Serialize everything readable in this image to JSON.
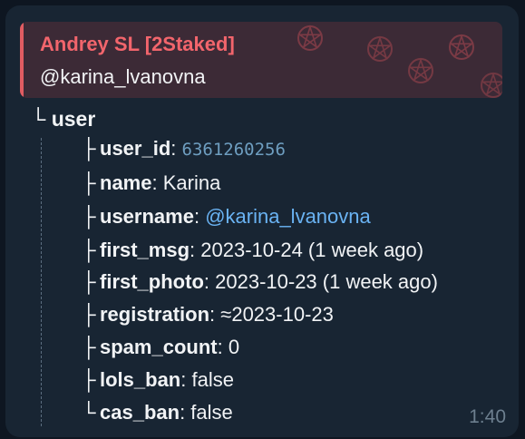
{
  "reply": {
    "name": "Andrey SL [2Staked]",
    "text": "@karina_lvanovna"
  },
  "tree": {
    "root_glyph": "└",
    "root_label": "user",
    "rows": [
      {
        "glyph": "├",
        "key": "user_id",
        "sep": ": ",
        "value": "6361260256",
        "style": "mono"
      },
      {
        "glyph": "├",
        "key": "name",
        "sep": ": ",
        "value": "Karina",
        "style": "plain"
      },
      {
        "glyph": "├",
        "key": "username",
        "sep": ": ",
        "value": "@karina_lvanovna",
        "style": "link"
      },
      {
        "glyph": "├",
        "key": "first_msg",
        "sep": ": ",
        "value": "2023-10-24 (1 week ago)",
        "style": "plain"
      },
      {
        "glyph": "├",
        "key": "first_photo",
        "sep": ": ",
        "value": "2023-10-23 (1 week ago)",
        "style": "plain"
      },
      {
        "glyph": "├",
        "key": "registration",
        "sep": ": ",
        "value": "≈2023-10-23",
        "style": "plain"
      },
      {
        "glyph": "├",
        "key": "spam_count",
        "sep": ": ",
        "value": "0",
        "style": "plain"
      },
      {
        "glyph": "├",
        "key": "lols_ban",
        "sep": ": ",
        "value": "false",
        "style": "plain"
      },
      {
        "glyph": "└",
        "key": "cas_ban",
        "sep": ": ",
        "value": "false",
        "style": "plain"
      }
    ]
  },
  "time": "1:40",
  "colors": {
    "background": "#0e1621",
    "bubble": "#182533",
    "accent_name": "#f2656c",
    "link": "#6ab3f3",
    "text": "#f1f3f5"
  },
  "icons": [
    "pentagram-icon"
  ]
}
